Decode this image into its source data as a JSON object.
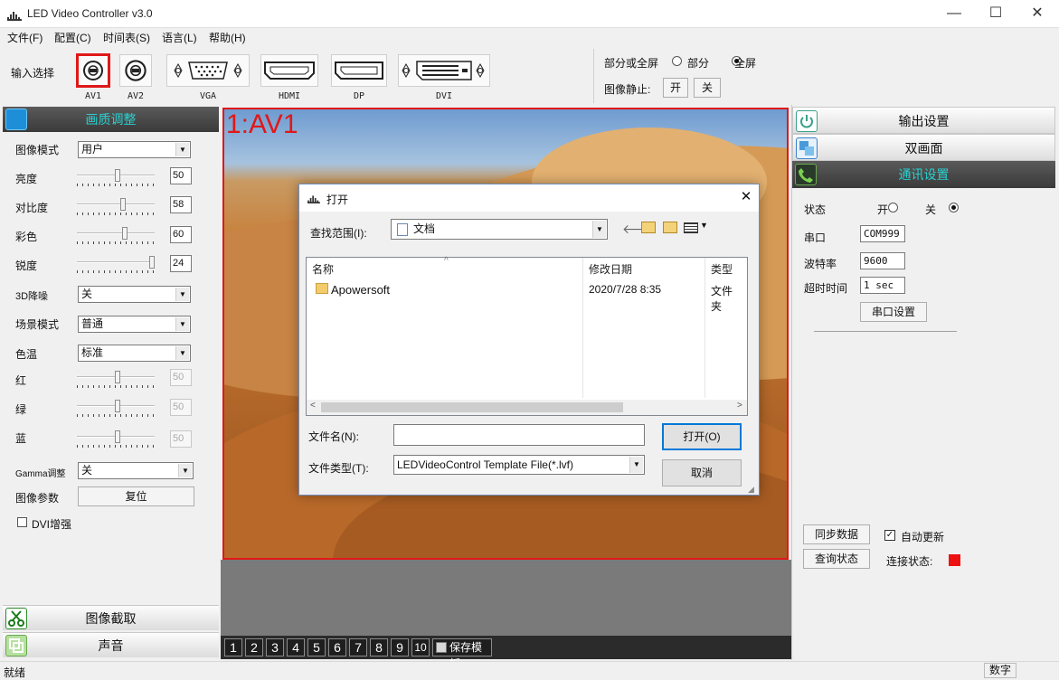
{
  "window": {
    "title": "LED Video Controller v3.0",
    "minimize": "—",
    "maximize": "☐",
    "close": "✕"
  },
  "menu": [
    "文件(F)",
    "配置(C)",
    "时间表(S)",
    "语言(L)",
    "帮助(H)"
  ],
  "input_select": {
    "label": "输入选择",
    "options": [
      "AV1",
      "AV2",
      "VGA",
      "HDMI",
      "DP",
      "DVI"
    ],
    "selected": "AV1"
  },
  "screen_mode": {
    "label": "部分或全屏",
    "partial": "部分",
    "full": "全屏",
    "selected": "全屏"
  },
  "freeze": {
    "label": "图像静止:",
    "on": "开",
    "off": "关"
  },
  "left_panel": {
    "header": "画质调整",
    "image_mode": {
      "label": "图像模式",
      "value": "用户"
    },
    "brightness": {
      "label": "亮度",
      "value": "50"
    },
    "contrast": {
      "label": "对比度",
      "value": "58"
    },
    "color": {
      "label": "彩色",
      "value": "60"
    },
    "sharpness": {
      "label": "锐度",
      "value": "24"
    },
    "nr3d": {
      "label": "3D降噪",
      "value": "关"
    },
    "scene_mode": {
      "label": "场景模式",
      "value": "普通"
    },
    "color_temp": {
      "label": "色温",
      "value": "标准"
    },
    "red": {
      "label": "红",
      "value": "50"
    },
    "green": {
      "label": "绿",
      "value": "50"
    },
    "blue": {
      "label": "蓝",
      "value": "50"
    },
    "gamma": {
      "label": "Gamma调整",
      "value": "关"
    },
    "image_params": {
      "label": "图像参数",
      "reset": "复位"
    },
    "dvi_enhance": {
      "label": "DVI增强",
      "checked": false
    },
    "capture": "图像截取",
    "sound": "声音"
  },
  "preview": {
    "label": "1:AV1"
  },
  "bottom_tabs": {
    "numbers": [
      "1",
      "2",
      "3",
      "4",
      "5",
      "6",
      "7",
      "8",
      "9",
      "10"
    ],
    "save_template": "保存模板"
  },
  "dialog": {
    "title": "打开",
    "lookin_label": "查找范围(I):",
    "lookin_value": "文档",
    "columns": {
      "name": "名称",
      "modified": "修改日期",
      "type": "类型"
    },
    "files": [
      {
        "name": "Apowersoft",
        "modified": "2020/7/28 8:35",
        "type": "文件夹"
      }
    ],
    "filename_label": "文件名(N):",
    "filename_value": "",
    "filetype_label": "文件类型(T):",
    "filetype_value": "LEDVideoControl Template File(*.lvf)",
    "open_btn": "打开(O)",
    "cancel_btn": "取消"
  },
  "right_panel": {
    "output_settings": "输出设置",
    "dual_screen": "双画面",
    "comm_settings": "通讯设置",
    "status": {
      "label": "状态",
      "on": "开",
      "off": "关",
      "selected": "关"
    },
    "port": {
      "label": "串口",
      "value": "COM999"
    },
    "baud": {
      "label": "波特率",
      "value": "9600"
    },
    "timeout": {
      "label": "超时时间",
      "value": "1 sec"
    },
    "port_settings_btn": "串口设置",
    "sync_btn": "同步数据",
    "auto_update": {
      "label": "自动更新",
      "checked": true
    },
    "query_btn": "查询状态",
    "conn_status": {
      "label": "连接状态:",
      "color": "#ee1111"
    }
  },
  "status_bar": {
    "left": "就绪",
    "right": "数字"
  },
  "colors": {
    "accent": "#2ad0d0",
    "highlight_red": "#e01818"
  }
}
